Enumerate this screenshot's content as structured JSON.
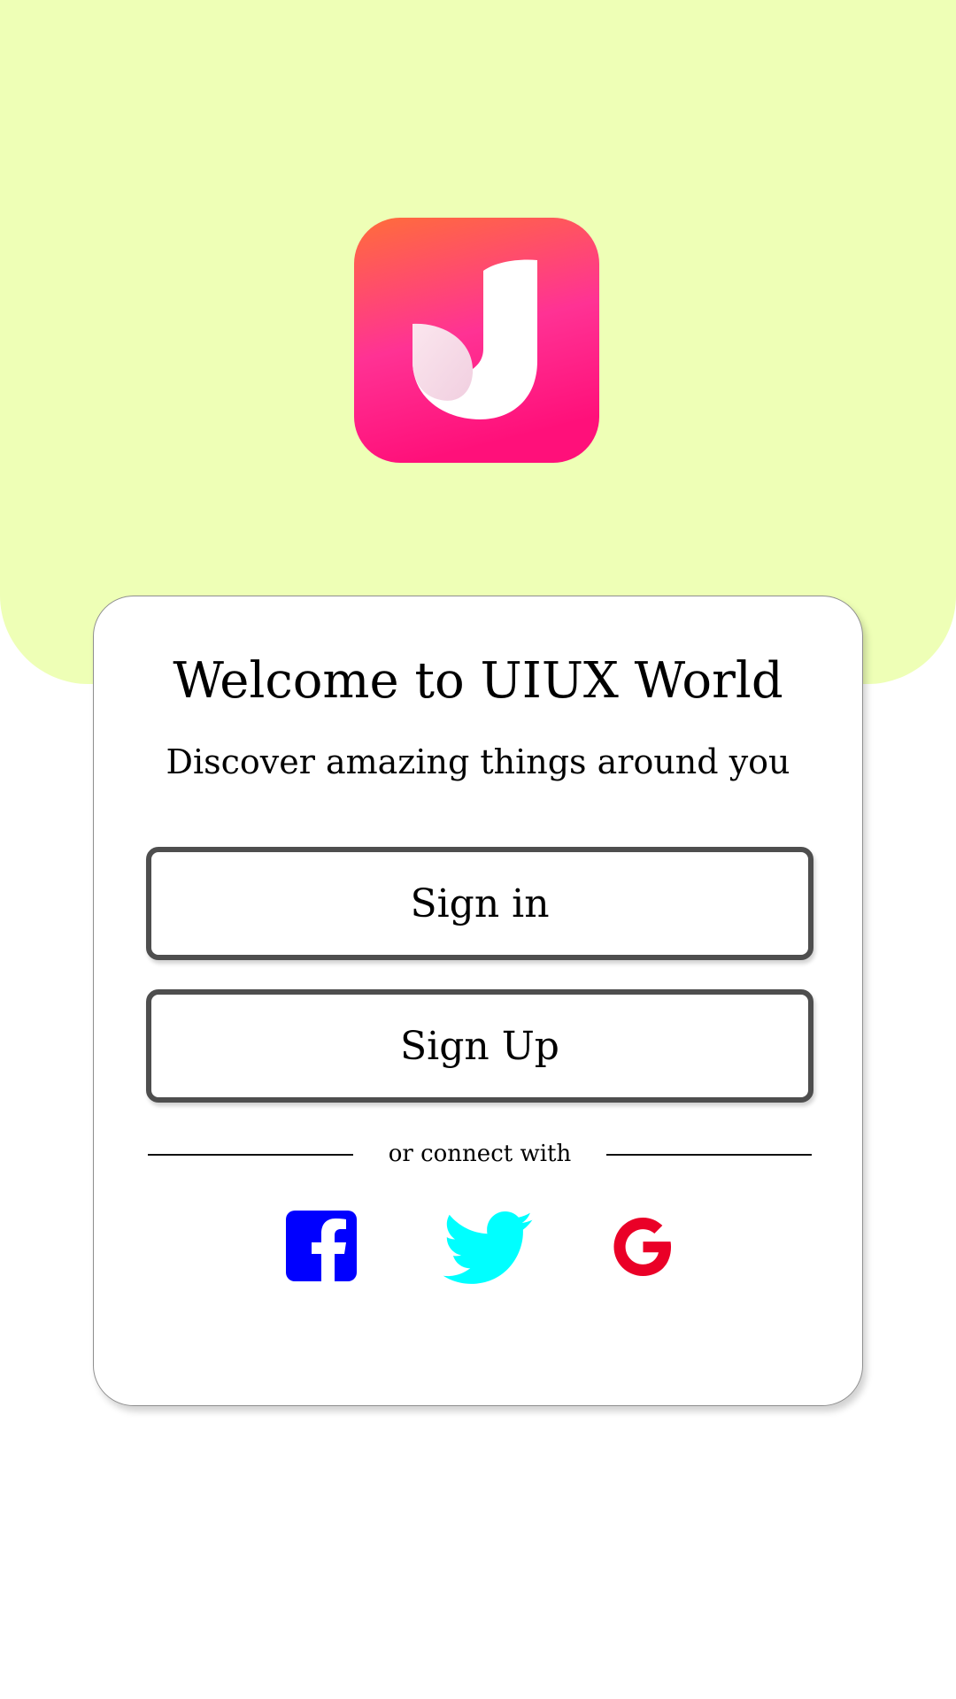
{
  "hero": {
    "background_color": "#eeffb6",
    "logo_icon": "app-logo-icon"
  },
  "card": {
    "title": "Welcome to UIUX World",
    "subtitle": "Discover amazing things around you",
    "signin_label": "Sign in",
    "signup_label": "Sign Up",
    "divider_text": "or connect with"
  },
  "social": [
    {
      "name": "facebook",
      "icon": "facebook-icon",
      "color": "#0000ff"
    },
    {
      "name": "twitter",
      "icon": "twitter-icon",
      "color": "#00ffff"
    },
    {
      "name": "google",
      "icon": "google-icon",
      "color": "#ea0027"
    }
  ],
  "colors": {
    "logo_gradient_top": "#ff6a3d",
    "logo_gradient_bottom": "#ff1a7a",
    "button_border": "#4e4e4e"
  }
}
